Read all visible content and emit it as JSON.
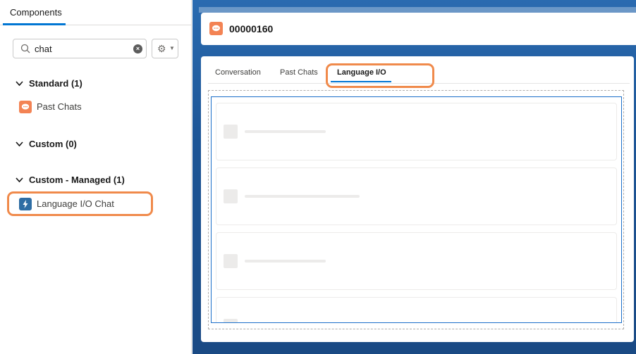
{
  "left_panel": {
    "tab_label": "Components",
    "search": {
      "value": "chat",
      "placeholder": ""
    },
    "sections": [
      {
        "label": "Standard (1)",
        "items": [
          {
            "label": "Past Chats",
            "icon": "chat-icon",
            "color": "#f38354"
          }
        ]
      },
      {
        "label": "Custom (0)",
        "items": []
      },
      {
        "label": "Custom - Managed (1)",
        "items": [
          {
            "label": "Language I/O Chat",
            "icon": "lightning-icon",
            "color": "#2e6da4"
          }
        ]
      }
    ]
  },
  "record": {
    "number": "00000160",
    "tabs": [
      "Conversation",
      "Past Chats",
      "Language I/O"
    ],
    "active_tab": "Language I/O"
  },
  "colors": {
    "accent": "#0176d3",
    "highlight": "#f08a4b",
    "chat_icon": "#f38354",
    "background": "#1b4f8d"
  }
}
